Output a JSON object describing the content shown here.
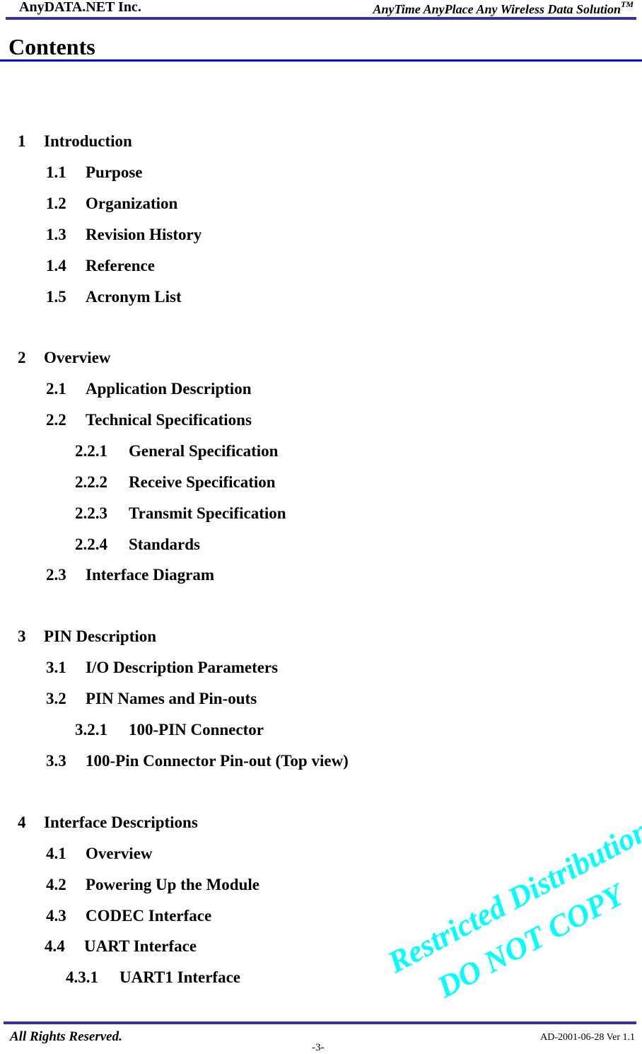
{
  "header": {
    "company": "AnyDATA.NET Inc.",
    "tagline": "AnyTime AnyPlace Any Wireless Data Solution",
    "tagline_mark": "TM",
    "rule_color": "#333399"
  },
  "title": {
    "text": "Contents",
    "rule_color": "#0000ee"
  },
  "toc": [
    {
      "num": "1",
      "label": "Introduction",
      "level": 1
    },
    {
      "num": "1.1",
      "label": "Purpose",
      "level": 2
    },
    {
      "num": "1.2",
      "label": "Organization",
      "level": 2
    },
    {
      "num": "1.3",
      "label": "Revision History",
      "level": 2
    },
    {
      "num": "1.4",
      "label": "Reference",
      "level": 2
    },
    {
      "num": "1.5",
      "label": "Acronym List",
      "level": 2
    },
    {
      "num": "2",
      "label": "Overview",
      "level": 1
    },
    {
      "num": "2.1",
      "label": "Application Description",
      "level": 2
    },
    {
      "num": "2.2",
      "label": "Technical Specifications",
      "level": 2
    },
    {
      "num": "2.2.1",
      "label": "General Specification",
      "level": 3
    },
    {
      "num": "2.2.2",
      "label": "Receive Specification",
      "level": 3
    },
    {
      "num": "2.2.3",
      "label": "Transmit Specification",
      "level": 3
    },
    {
      "num": "2.2.4",
      "label": "Standards",
      "level": 3
    },
    {
      "num": "2.3",
      "label": "Interface Diagram",
      "level": 2
    },
    {
      "num": "3",
      "label": "PIN Description",
      "level": 1
    },
    {
      "num": "3.1",
      "label": "I/O Description Parameters",
      "level": 2
    },
    {
      "num": "3.2",
      "label": "PIN Names and Pin-outs",
      "level": 2
    },
    {
      "num": "3.2.1",
      "label": "100-PIN Connector",
      "level": 3
    },
    {
      "num": "3.3",
      "label": "100-Pin Connector Pin-out (Top view)",
      "level": 2
    },
    {
      "num": "4",
      "label": "Interface Descriptions",
      "level": 1
    },
    {
      "num": "4.1",
      "label": "Overview",
      "level": 2
    },
    {
      "num": "4.2",
      "label": "Powering Up the Module",
      "level": 2
    },
    {
      "num": "4.3",
      "label": "CODEC Interface",
      "level": 2
    },
    {
      "num": "4.4",
      "label": "UART Interface",
      "level": 2
    },
    {
      "num": "4.3.1",
      "label": "UART1 Interface",
      "level": 3
    }
  ],
  "watermark": {
    "line1": "Restricted Distribution",
    "line2": "DO NOT COPY",
    "color": "#00ffff"
  },
  "footer": {
    "rights": "All Rights Reserved.",
    "doc_id": "AD-2001-06-28 Ver 1.1",
    "page": "-3-"
  }
}
